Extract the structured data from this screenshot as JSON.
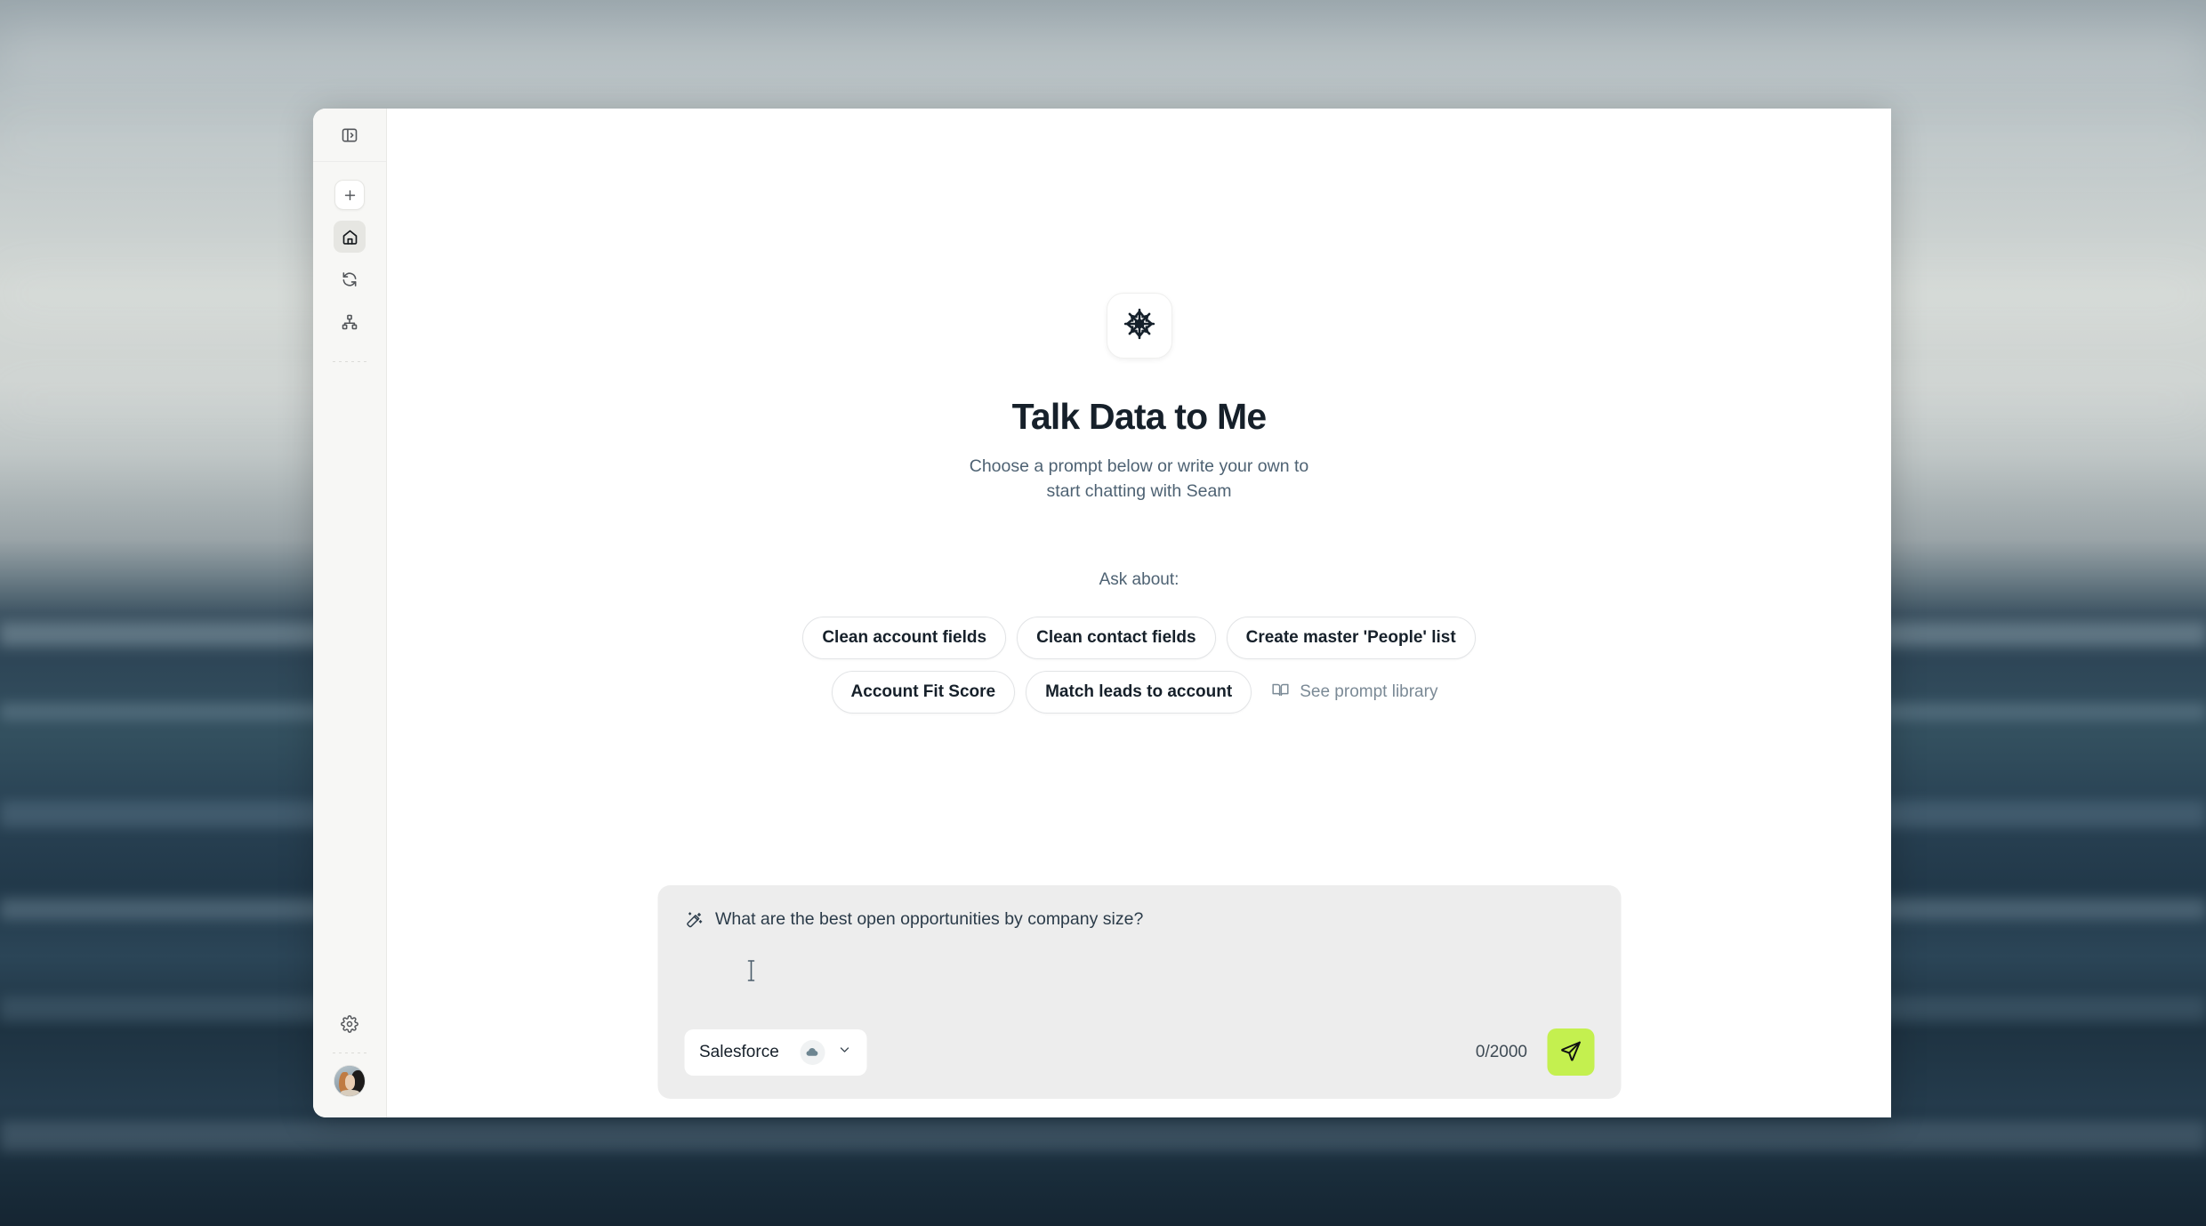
{
  "window": {
    "sidebar": {
      "toggle": {
        "label": "Expand sidebar",
        "icon": "panel-expand-icon"
      },
      "items": [
        {
          "id": "new",
          "label": "New chat",
          "icon": "plus-icon",
          "active": false
        },
        {
          "id": "home",
          "label": "Home",
          "icon": "home-icon",
          "active": true
        },
        {
          "id": "sync",
          "label": "Sync",
          "icon": "refresh-icon",
          "active": false
        },
        {
          "id": "sitemap",
          "label": "Data model",
          "icon": "sitemap-icon",
          "active": false
        }
      ],
      "bottom": [
        {
          "id": "settings",
          "label": "Settings",
          "icon": "gear-icon"
        },
        {
          "id": "profile",
          "label": "Account",
          "icon": "avatar"
        }
      ]
    },
    "hero": {
      "logo_icon": "snowflake-starburst-icon",
      "title": "Talk Data to Me",
      "subtitle_line1": "Choose a prompt below or write your own to",
      "subtitle_line2": "start chatting with Seam"
    },
    "prompts": {
      "ask_label": "Ask about:",
      "row1": [
        "Clean account fields",
        "Clean contact fields",
        "Create master 'People' list"
      ],
      "row2": [
        "Account Fit Score",
        "Match leads to account"
      ],
      "library_link": "See prompt library",
      "library_icon": "book-open-icon"
    },
    "composer": {
      "wand_icon": "magic-wand-icon",
      "placeholder": "What are the best open opportunities by company size?",
      "value": "",
      "source": {
        "label": "Salesforce",
        "icon": "cloud-icon",
        "chevron": "chevron-down-icon"
      },
      "char_count": "0/2000",
      "send_icon": "send-paper-plane-icon"
    }
  },
  "colors": {
    "accent_send": "#c4f04f",
    "title": "#16202a",
    "muted": "#4e6273",
    "sidebar_bg": "#f7f7f5",
    "composer_bg": "#ededed"
  }
}
